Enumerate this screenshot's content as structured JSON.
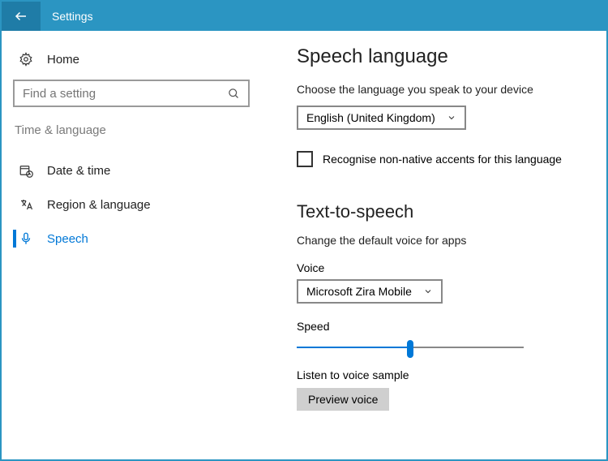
{
  "header": {
    "title": "Settings"
  },
  "sidebar": {
    "home": "Home",
    "search_placeholder": "Find a setting",
    "category": "Time & language",
    "items": [
      {
        "label": "Date & time"
      },
      {
        "label": "Region & language"
      },
      {
        "label": "Speech"
      }
    ]
  },
  "main": {
    "section1_title": "Speech language",
    "section1_desc": "Choose the language you speak to your device",
    "language_selected": "English (United Kingdom)",
    "checkbox_label": "Recognise non-native accents for this language",
    "section2_title": "Text-to-speech",
    "section2_desc": "Change the default voice for apps",
    "voice_label": "Voice",
    "voice_selected": "Microsoft Zira Mobile",
    "speed_label": "Speed",
    "speed_percent": 50,
    "sample_label": "Listen to voice sample",
    "preview_button": "Preview voice"
  },
  "colors": {
    "accent": "#0078d7",
    "header": "#2b95c2"
  }
}
